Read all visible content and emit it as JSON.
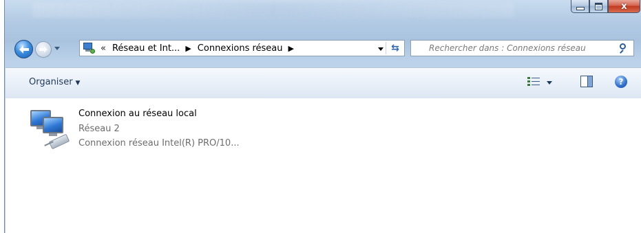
{
  "window": {
    "caption": {
      "minimize": "minimize",
      "maximize": "maximize",
      "close": "x"
    }
  },
  "navigation": {
    "back_icon": "back-arrow-icon",
    "forward_icon": "forward-arrow-icon",
    "address": {
      "overflow": "«",
      "crumbs": [
        "Réseau et Int...",
        "Connexions réseau"
      ],
      "separator": "▶"
    },
    "search": {
      "placeholder": "Rechercher dans : Connexions réseau"
    }
  },
  "command_bar": {
    "organise_label": "Organiser",
    "dropdown_glyph": "▼"
  },
  "items": [
    {
      "title": "Connexion au réseau local",
      "network": "Réseau  2",
      "adapter": "Connexion réseau Intel(R) PRO/10..."
    }
  ],
  "colors": {
    "command_bar_text": "#1e395b",
    "secondary_text": "#6d6d6d",
    "close_button": "#c1391f"
  }
}
